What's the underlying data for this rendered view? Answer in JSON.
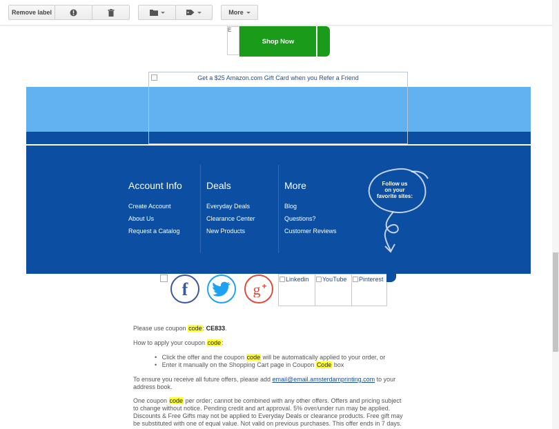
{
  "toolbar": {
    "remove_label": "Remove label",
    "more_label": "More"
  },
  "banner": {
    "shop_now": "Shop Now",
    "shop_broken_alt": "E",
    "gift_text": "Get a $25 Amazon.com Gift Card when you Refer a Friend"
  },
  "footer": {
    "cols": [
      {
        "title": "Account Info",
        "links": [
          "Create Account",
          "About Us",
          "Request a Catalog"
        ]
      },
      {
        "title": "Deals",
        "links": [
          "Everyday Deals",
          "Clearance Center",
          "New Products"
        ]
      },
      {
        "title": "More",
        "links": [
          "Blog",
          "Questions?",
          "Customer Reviews"
        ]
      }
    ],
    "follow_lines": [
      "Follow us",
      "on your",
      "favorite sites:"
    ]
  },
  "social": {
    "linkedin": "Linkedin",
    "youtube": "YouTube",
    "pinterest": "Pinterest"
  },
  "body": {
    "coupon_pre": "Please use coupon ",
    "coupon_word": "code",
    "coupon_colon": ": ",
    "coupon_value": "CE833",
    "coupon_end": ".",
    "howto_pre": "How to apply your coupon ",
    "howto_word": "code",
    "howto_end": ":",
    "b1_pre": "Click the offer and the coupon ",
    "b1_word": "code",
    "b1_post": " will be automatically applied to your order, or",
    "b2_pre": "Enter it manually on the Shopping Cart page in Coupon ",
    "b2_word": "Code",
    "b2_post": " box",
    "ensure_pre": "To ensure you receive all future offers, please add ",
    "ensure_email": "email@email.amsterdamprinting.com",
    "ensure_post": " to your",
    "ensure_line2": "address book.",
    "terms_l1_pre": "One coupon ",
    "terms_l1_word": "code",
    "terms_l1_post": " per order; cannot be combined with any other offers. Offers and pricing subject",
    "terms_l2": "to change without notice. Pending credit and art approval. 5% over/under run may be applied.",
    "terms_l3": "Discounts & Free Gifts may not be applied to Everyday Deals or clearance products. Free gift may",
    "terms_l4": "be substituted with one of equal value. Not valid on previous purchases. This offer ends in 7 days."
  }
}
